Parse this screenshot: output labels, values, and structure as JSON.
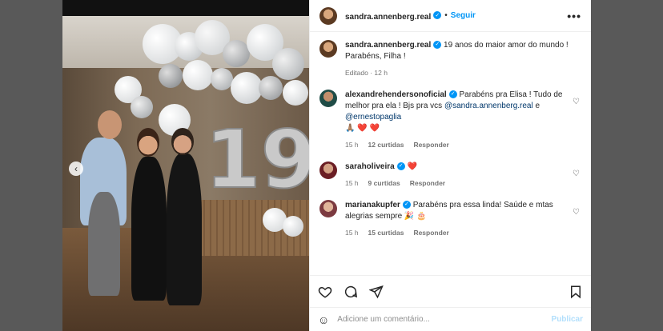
{
  "post": {
    "username": "sandra.annenberg.real",
    "follow_label": "Seguir",
    "more_label": "•••",
    "dot": "•"
  },
  "caption": {
    "username": "sandra.annenberg.real",
    "text": "19 anos do maior amor do mundo ! Parabéns, Filha !",
    "edited": "Editado · 12 h"
  },
  "comments": [
    {
      "username": "alexandrehendersonoficial",
      "text_before": "Parabéns pra Elisa ! Tudo de melhor pra ela ! Bjs pra vcs ",
      "mention1": "@sandra.annenberg.real",
      "connector": " e ",
      "mention2": "@ernestopaglia",
      "emoji_line": "🙏🏽 ❤️ ❤️",
      "time": "15 h",
      "likes": "12 curtidas",
      "reply": "Responder"
    },
    {
      "username": "saraholiveira",
      "text": "❤️",
      "time": "15 h",
      "likes": "9 curtidas",
      "reply": "Responder"
    },
    {
      "username": "marianakupfer",
      "text": "Parabéns pra essa linda! Saúde e mtas alegrias sempre 🎉 🎂",
      "time": "15 h",
      "likes": "15 curtidas",
      "reply": "Responder"
    }
  ],
  "photo": {
    "balloon_number": "19"
  },
  "add_comment": {
    "placeholder": "Adicione um comentário...",
    "publish": "Publicar"
  },
  "icons": {
    "heart": "heart-icon",
    "comment": "comment-icon",
    "share": "share-icon",
    "save": "bookmark-icon",
    "emoji": "emoji-icon",
    "nav": "chevron-left-icon"
  },
  "colors": {
    "accent": "#0095f6",
    "publish_disabled": "#b2dffc",
    "like_heart": "#ed4956"
  }
}
